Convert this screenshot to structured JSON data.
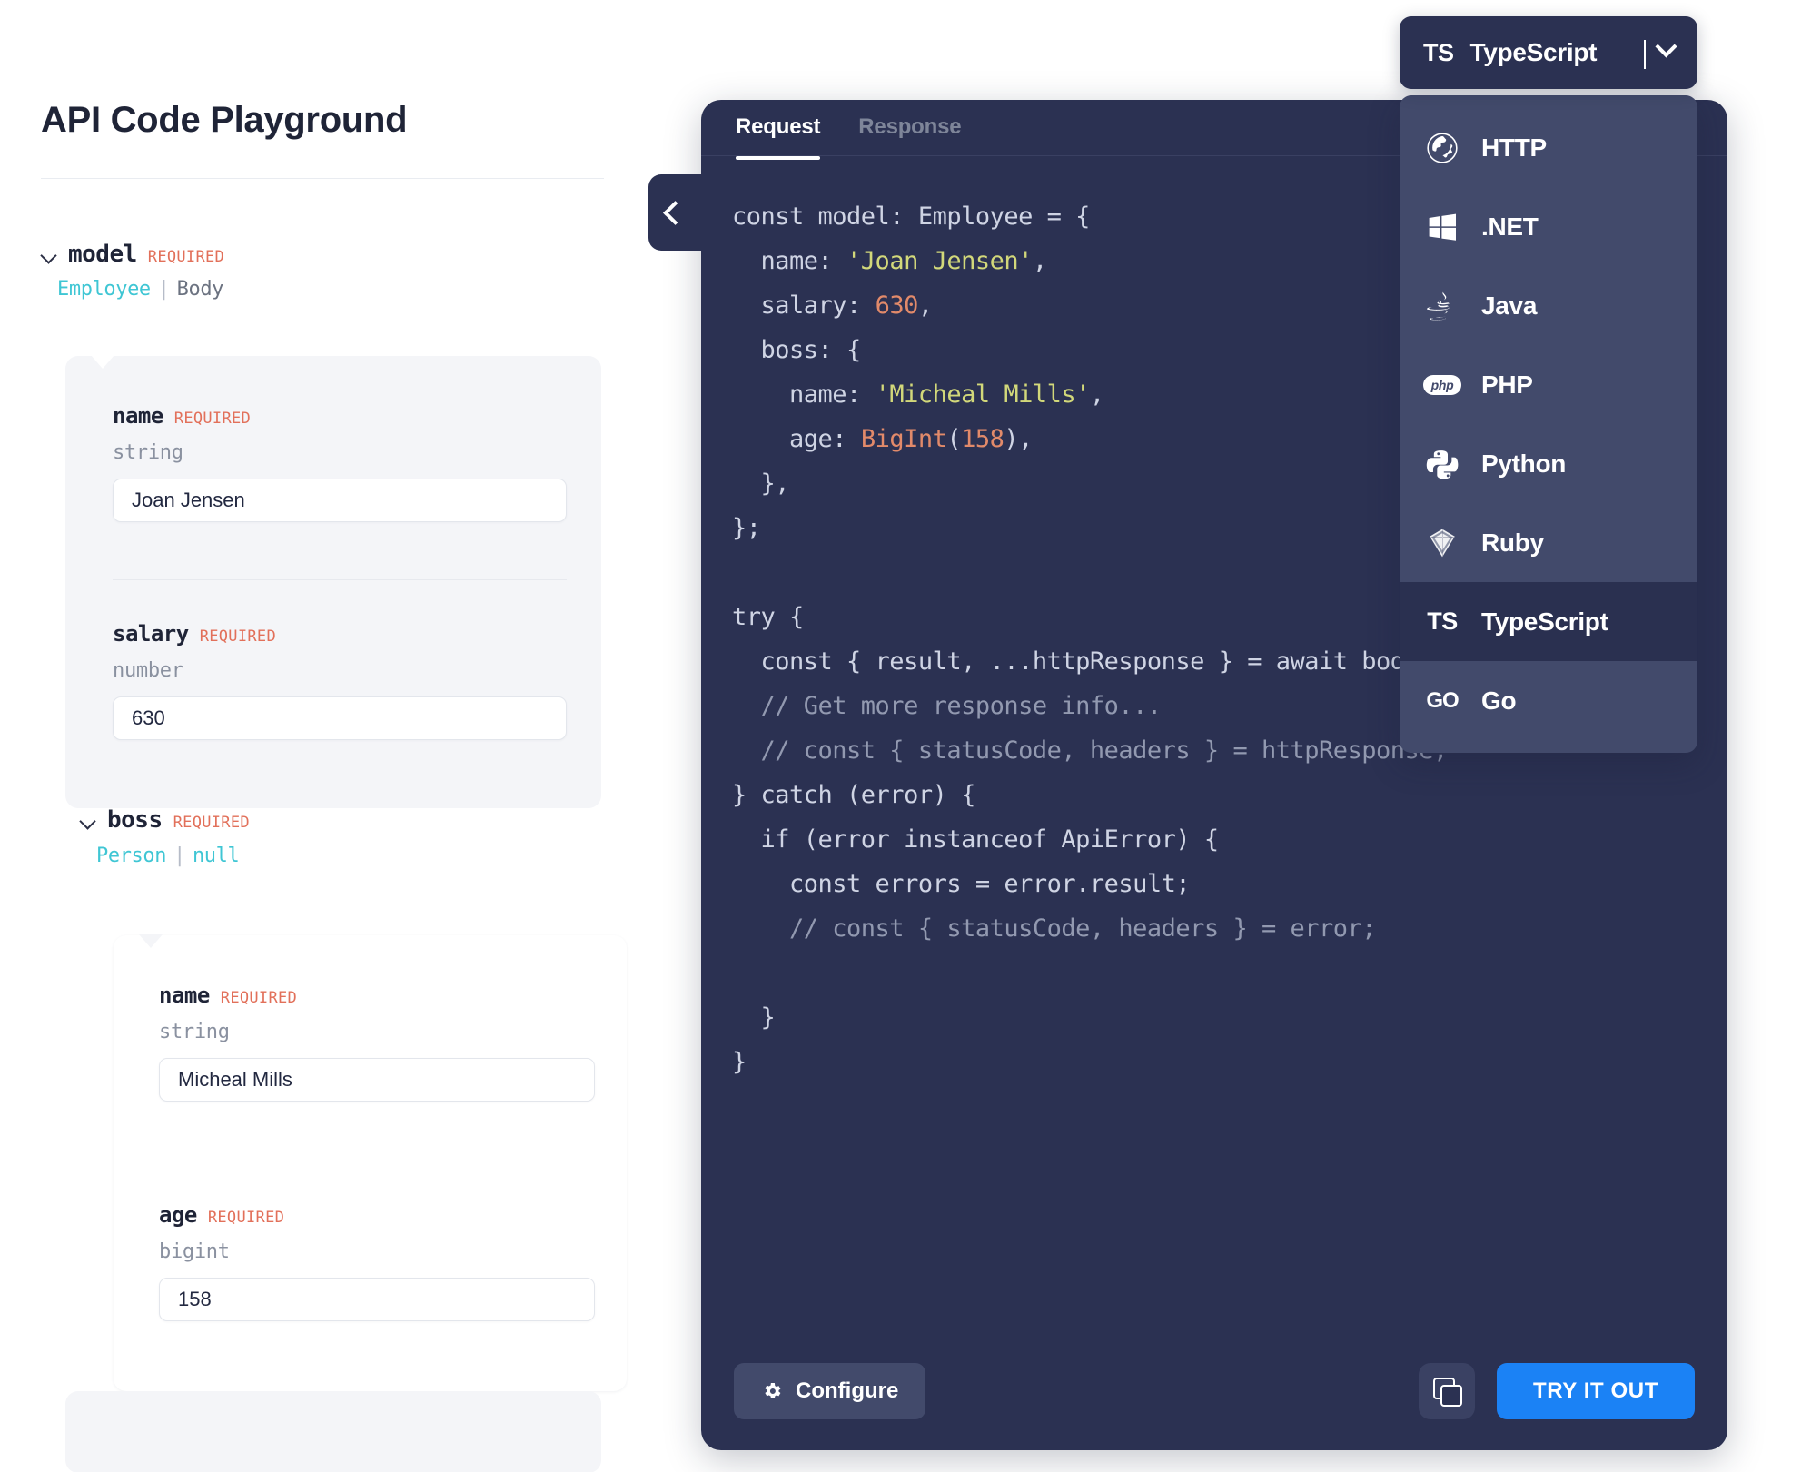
{
  "left": {
    "title": "API Code Playground",
    "required_label": "REQUIRED",
    "model": {
      "name": "model",
      "required": "REQUIRED",
      "type_link": "Employee",
      "type_sep": "|",
      "type_plain": "Body"
    },
    "fields": [
      {
        "name": "name",
        "required": "REQUIRED",
        "type": "string",
        "value": "Joan Jensen"
      },
      {
        "name": "salary",
        "required": "REQUIRED",
        "type": "number",
        "value": "630"
      }
    ],
    "boss": {
      "name": "boss",
      "required": "REQUIRED",
      "type_link": "Person",
      "type_sep": "|",
      "type_null": "null",
      "fields": [
        {
          "name": "name",
          "required": "REQUIRED",
          "type": "string",
          "value": "Micheal Mills"
        },
        {
          "name": "age",
          "required": "REQUIRED",
          "type": "bigint",
          "value": "158"
        }
      ]
    }
  },
  "language_selector": {
    "badge": "TS",
    "selected": "TypeScript",
    "caret_icon": "chevron-down-icon",
    "options": [
      {
        "label": "HTTP",
        "icon": "globe-icon",
        "selected": false
      },
      {
        "label": ".NET",
        "icon": "windows-icon",
        "selected": false
      },
      {
        "label": "Java",
        "icon": "java-icon",
        "selected": false
      },
      {
        "label": "PHP",
        "icon": "php-icon",
        "selected": false
      },
      {
        "label": "Python",
        "icon": "python-icon",
        "selected": false
      },
      {
        "label": "Ruby",
        "icon": "ruby-icon",
        "selected": false
      },
      {
        "label": "TypeScript",
        "icon": "typescript-icon",
        "selected": true
      },
      {
        "label": "Go",
        "icon": "go-icon",
        "selected": false
      }
    ]
  },
  "code_panel": {
    "collapse_icon": "chevron-left-icon",
    "tabs": [
      {
        "label": "Request",
        "active": true
      },
      {
        "label": "Response",
        "active": false
      }
    ],
    "code_lines": [
      "const model: Employee = {",
      "  name: 'Joan Jensen',",
      "  salary: 630,",
      "  boss: {",
      "    name: 'Micheal Mills',",
      "    age: BigInt(158),",
      "  },",
      "};",
      "",
      "try {",
      "  const { result, ...httpResponse } = await bodyParamsCor",
      "  // Get more response info...",
      "  // const { statusCode, headers } = httpResponse;",
      "} catch (error) {",
      "  if (error instanceof ApiError) {",
      "    const errors = error.result;",
      "    // const { statusCode, headers } = error;",
      "  }",
      "}"
    ],
    "actions": {
      "configure_label": "Configure",
      "configure_icon": "gear-icon",
      "copy_icon": "copy-icon",
      "try_label": "TRY IT OUT"
    }
  },
  "colors": {
    "code_bg": "#2b3152",
    "menu_bg": "#424a6b",
    "menu_selected_bg": "#2a3050",
    "accent_blue": "#1b82f5",
    "required_red": "#e2705a",
    "type_teal": "#3fc6d4",
    "string_yellow": "#d2d87a",
    "number_orange": "#e28a6a"
  }
}
